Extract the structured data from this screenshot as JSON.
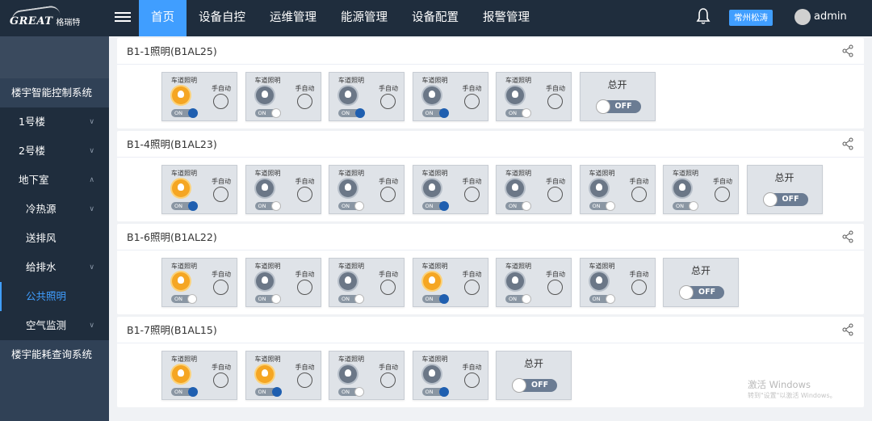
{
  "app": {
    "brand": "GREAT",
    "brand_cn": "格瑞特",
    "user": "admin",
    "region": "常州松涛"
  },
  "nav": [
    "首页",
    "设备自控",
    "运维管理",
    "能源管理",
    "设备配置",
    "报警管理"
  ],
  "sidebar": {
    "items": [
      "楼宇智能控制系统",
      "1号楼",
      "2号楼",
      "地下室",
      "冷热源",
      "送排风",
      "给排水",
      "公共照明",
      "空气监测",
      "楼宇能耗查询系统"
    ]
  },
  "labels": {
    "lamp": "车道照明",
    "mode": "手自动",
    "sw_on": "ON",
    "master": "总开",
    "master_off": "OFF"
  },
  "groups": [
    {
      "title": "B1-1照明(B1AL25)",
      "lamps": [
        {
          "lit": true,
          "switch": "dark"
        },
        {
          "lit": false,
          "switch": "light"
        },
        {
          "lit": false,
          "switch": "dark"
        },
        {
          "lit": false,
          "switch": "dark"
        },
        {
          "lit": false,
          "switch": "light"
        }
      ]
    },
    {
      "title": "B1-4照明(B1AL23)",
      "lamps": [
        {
          "lit": true,
          "switch": "dark"
        },
        {
          "lit": false,
          "switch": "light"
        },
        {
          "lit": false,
          "switch": "light"
        },
        {
          "lit": false,
          "switch": "dark"
        },
        {
          "lit": false,
          "switch": "light"
        },
        {
          "lit": false,
          "switch": "light"
        },
        {
          "lit": false,
          "switch": "light"
        }
      ]
    },
    {
      "title": "B1-6照明(B1AL22)",
      "lamps": [
        {
          "lit": true,
          "switch": "light"
        },
        {
          "lit": false,
          "switch": "light"
        },
        {
          "lit": false,
          "switch": "light"
        },
        {
          "lit": true,
          "switch": "dark"
        },
        {
          "lit": false,
          "switch": "light"
        },
        {
          "lit": false,
          "switch": "light"
        }
      ]
    },
    {
      "title": "B1-7照明(B1AL15)",
      "lamps": [
        {
          "lit": true,
          "switch": "dark"
        },
        {
          "lit": true,
          "switch": "dark"
        },
        {
          "lit": false,
          "switch": "light"
        },
        {
          "lit": false,
          "switch": "dark"
        }
      ]
    }
  ],
  "watermark": {
    "line1": "激活 Windows",
    "line2": "转到\"设置\"以激活 Windows。"
  }
}
